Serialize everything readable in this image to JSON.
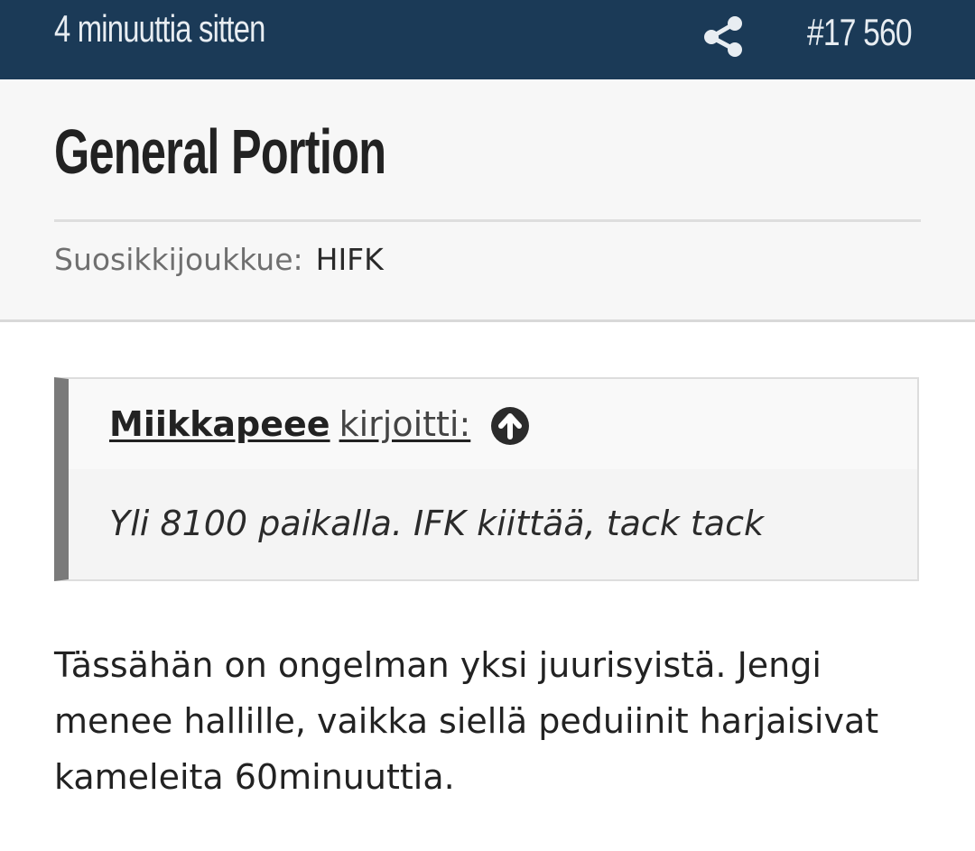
{
  "header": {
    "time_ago": "4 minuuttia sitten",
    "share_icon": "share-icon",
    "post_number": "#17 560",
    "background_color": "#1b3a57"
  },
  "author": {
    "username": "General Portion",
    "favorite_team_label": "Suosikkijoukkue:",
    "favorite_team_value": "HIFK"
  },
  "quote": {
    "author_name": "Miikkapeee",
    "wrote_label": "kirjoitti:",
    "jump_icon": "arrow-up-circle-icon",
    "text": "Yli 8100 paikalla. IFK kiittää, tack tack"
  },
  "post": {
    "body": "Tässähän on ongelman yksi juurisyistä. Jengi menee hallille, vaikka siellä peduiinit harjaisivat kameleita 60minuuttia."
  }
}
